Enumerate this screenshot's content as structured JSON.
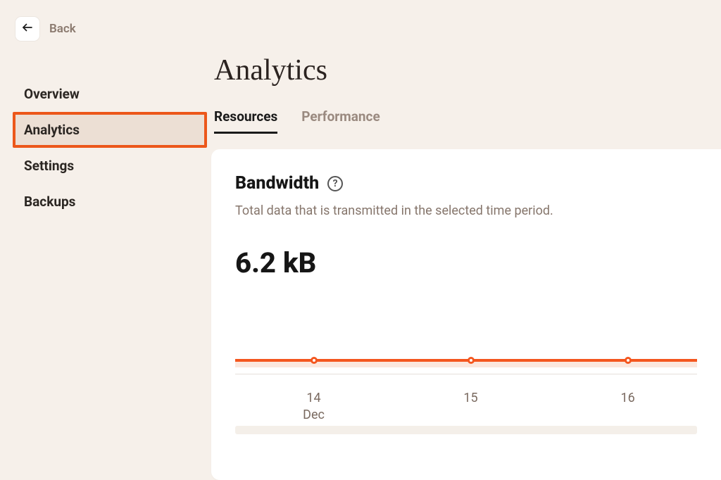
{
  "back": {
    "label": "Back"
  },
  "sidebar": {
    "items": [
      {
        "label": "Overview",
        "active": false
      },
      {
        "label": "Analytics",
        "active": true
      },
      {
        "label": "Settings",
        "active": false
      },
      {
        "label": "Backups",
        "active": false
      }
    ]
  },
  "page": {
    "title": "Analytics"
  },
  "tabs": [
    {
      "label": "Resources",
      "active": true
    },
    {
      "label": "Performance",
      "active": false
    }
  ],
  "bandwidth": {
    "title": "Bandwidth",
    "description": "Total data that is transmitted in the selected time period.",
    "value": "6.2 kB"
  },
  "accent_color": "#f4561e",
  "highlight_border_color": "#ec571a",
  "chart_data": {
    "type": "line",
    "title": "Bandwidth",
    "ylabel": "",
    "xlabel": "",
    "x_points": [
      {
        "label_top": "14",
        "label_bottom": "Dec",
        "pos_pct": 17
      },
      {
        "label_top": "15",
        "label_bottom": "",
        "pos_pct": 51
      },
      {
        "label_top": "16",
        "label_bottom": "",
        "pos_pct": 85
      }
    ],
    "series": [
      {
        "name": "bandwidth",
        "values": [
          0,
          0,
          0
        ]
      }
    ],
    "ylim": [
      0,
      0
    ]
  }
}
